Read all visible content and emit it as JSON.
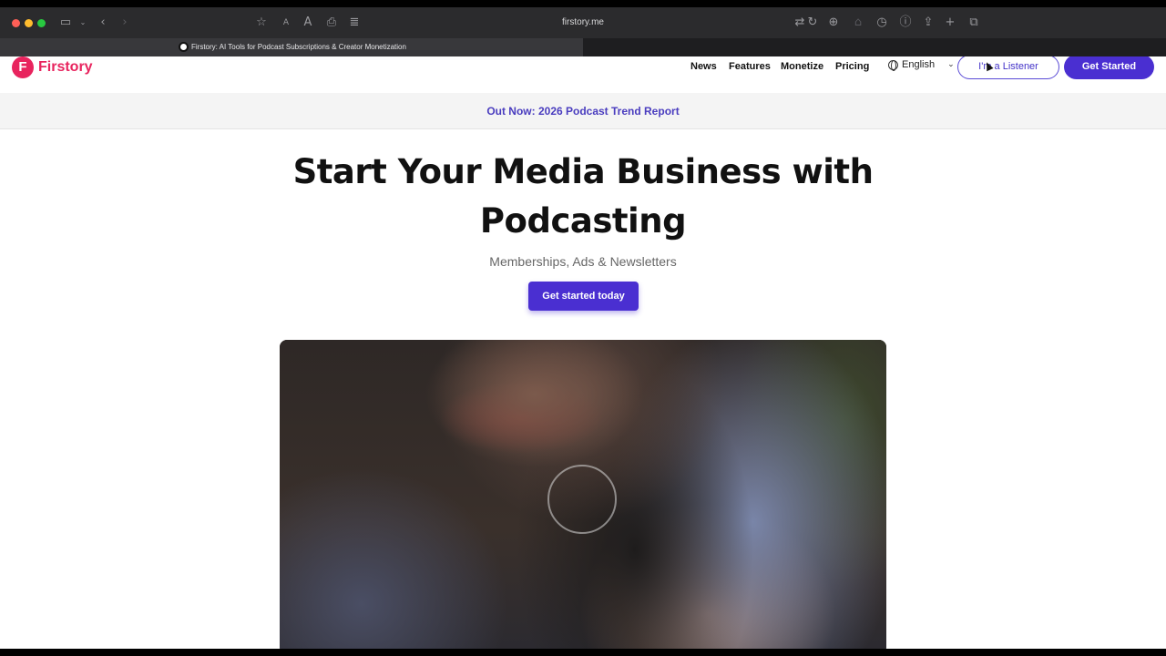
{
  "browser": {
    "url": "firstory.me",
    "tab_title": "Firstory: AI Tools for Podcast Subscriptions & Creator Monetization"
  },
  "header": {
    "logo_text": "Firstory",
    "nav": [
      "News",
      "Features",
      "Monetize",
      "Pricing"
    ],
    "language": "English",
    "listener_label": "I'm a Listener",
    "get_started_label": "Get Started"
  },
  "announcement": {
    "text": "Out Now: 2026 Podcast Trend Report"
  },
  "hero": {
    "title": "Start Your Media Business with Podcasting",
    "subtitle": "Memberships, Ads & Newsletters",
    "cta": "Get started today"
  },
  "colors": {
    "brand_pink": "#e8245e",
    "brand_purple": "#4a2fd1"
  }
}
